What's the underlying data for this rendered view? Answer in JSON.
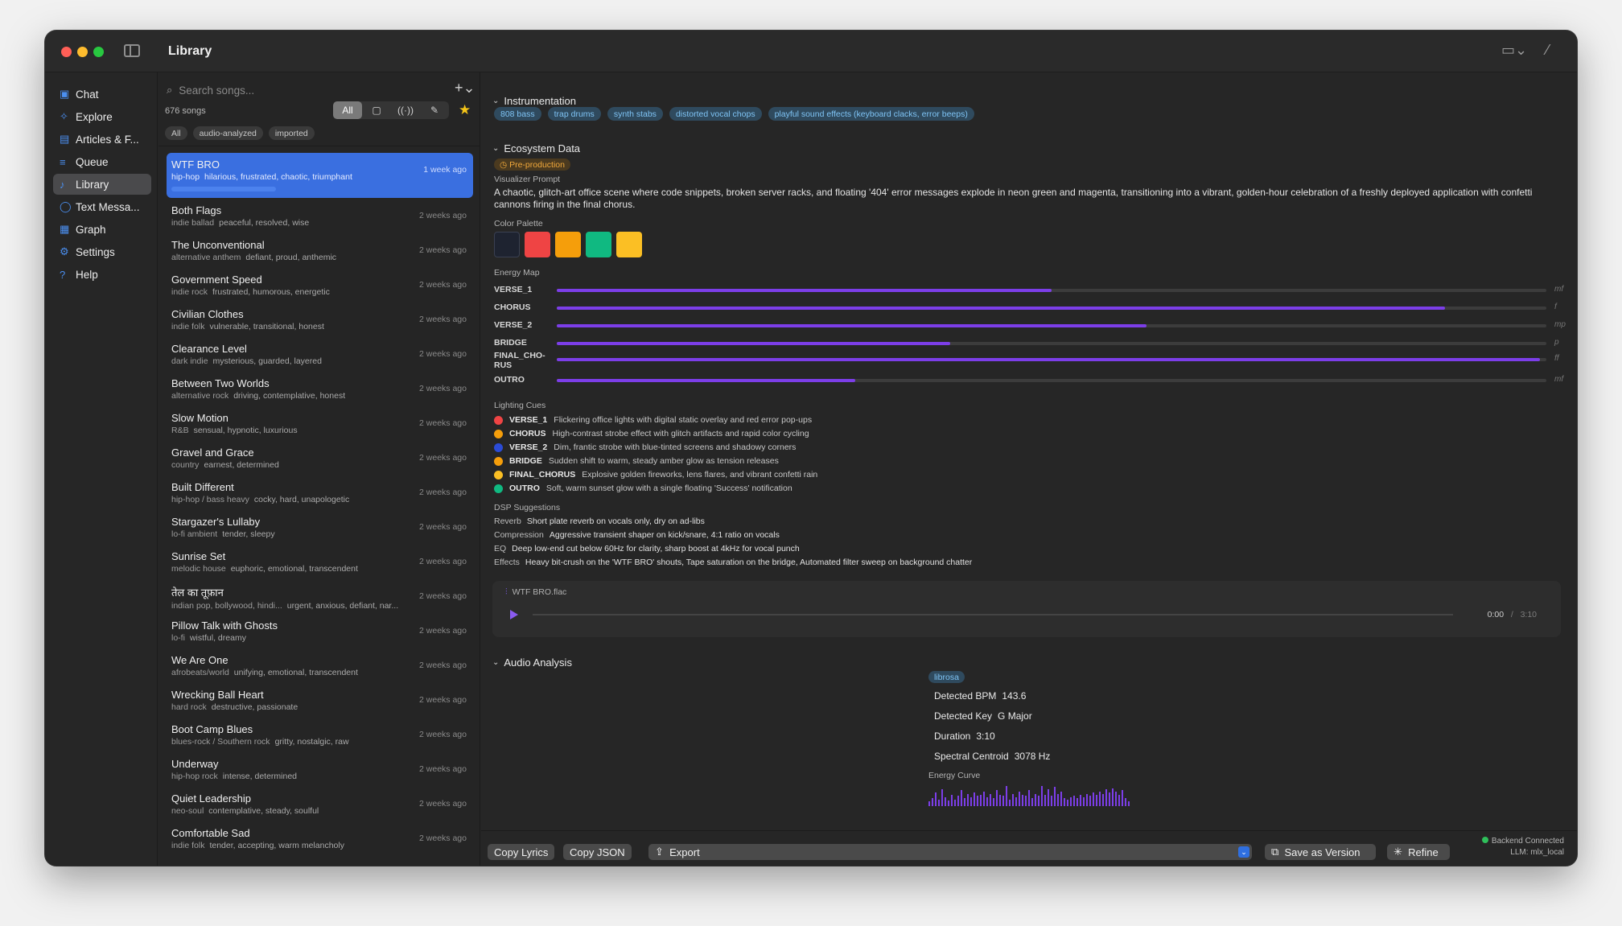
{
  "window": {
    "title": "Library"
  },
  "sidebar": {
    "items": [
      {
        "label": "Chat",
        "icon": "chat-bubbles-icon",
        "glyph": "▣"
      },
      {
        "label": "Explore",
        "icon": "sparkles-icon",
        "glyph": "✧"
      },
      {
        "label": "Articles & F...",
        "icon": "newspaper-icon",
        "glyph": "▤"
      },
      {
        "label": "Queue",
        "icon": "list-icon",
        "glyph": "≡"
      },
      {
        "label": "Library",
        "icon": "music-note-icon",
        "glyph": "♪",
        "active": true
      },
      {
        "label": "Text Messa...",
        "icon": "message-icon",
        "glyph": "◯"
      },
      {
        "label": "Graph",
        "icon": "grid-icon",
        "glyph": "▦"
      },
      {
        "label": "Settings",
        "icon": "gear-icon",
        "glyph": "⚙"
      },
      {
        "label": "Help",
        "icon": "question-icon",
        "glyph": "?"
      }
    ]
  },
  "library": {
    "search_placeholder": "Search songs...",
    "count": "676 songs",
    "filter_all": "All",
    "chips": [
      "All",
      "audio-analyzed",
      "imported"
    ],
    "songs": [
      {
        "title": "WTF BRO",
        "genre": "hip-hop",
        "moods": "hilarious, frustrated, chaotic, triumphant",
        "when": "1 week ago",
        "selected": true
      },
      {
        "title": "Both Flags",
        "genre": "indie ballad",
        "moods": "peaceful, resolved, wise",
        "when": "2 weeks ago"
      },
      {
        "title": "The Unconventional",
        "genre": "alternative anthem",
        "moods": "defiant, proud, anthemic",
        "when": "2 weeks ago"
      },
      {
        "title": "Government Speed",
        "genre": "indie rock",
        "moods": "frustrated, humorous, energetic",
        "when": "2 weeks ago"
      },
      {
        "title": "Civilian Clothes",
        "genre": "indie folk",
        "moods": "vulnerable, transitional, honest",
        "when": "2 weeks ago"
      },
      {
        "title": "Clearance Level",
        "genre": "dark indie",
        "moods": "mysterious, guarded, layered",
        "when": "2 weeks ago"
      },
      {
        "title": "Between Two Worlds",
        "genre": "alternative rock",
        "moods": "driving, contemplative, honest",
        "when": "2 weeks ago"
      },
      {
        "title": "Slow Motion",
        "genre": "R&B",
        "moods": "sensual, hypnotic, luxurious",
        "when": "2 weeks ago"
      },
      {
        "title": "Gravel and Grace",
        "genre": "country",
        "moods": "earnest, determined",
        "when": "2 weeks ago"
      },
      {
        "title": "Built Different",
        "genre": "hip-hop / bass heavy",
        "moods": "cocky, hard, unapologetic",
        "when": "2 weeks ago"
      },
      {
        "title": "Stargazer's Lullaby",
        "genre": "lo-fi ambient",
        "moods": "tender, sleepy",
        "when": "2 weeks ago"
      },
      {
        "title": "Sunrise Set",
        "genre": "melodic house",
        "moods": "euphoric, emotional, transcendent",
        "when": "2 weeks ago"
      },
      {
        "title": "तेल का तूफ़ान",
        "genre": "indian pop, bollywood, hindi...",
        "moods": "urgent, anxious, defiant, nar...",
        "when": "2 weeks ago"
      },
      {
        "title": "Pillow Talk with Ghosts",
        "genre": "lo-fi",
        "moods": "wistful, dreamy",
        "when": "2 weeks ago"
      },
      {
        "title": "We Are One",
        "genre": "afrobeats/world",
        "moods": "unifying, emotional, transcendent",
        "when": "2 weeks ago"
      },
      {
        "title": "Wrecking Ball Heart",
        "genre": "hard rock",
        "moods": "destructive, passionate",
        "when": "2 weeks ago"
      },
      {
        "title": "Boot Camp Blues",
        "genre": "blues-rock / Southern rock",
        "moods": "gritty, nostalgic, raw",
        "when": "2 weeks ago"
      },
      {
        "title": "Underway",
        "genre": "hip-hop rock",
        "moods": "intense, determined",
        "when": "2 weeks ago"
      },
      {
        "title": "Quiet Leadership",
        "genre": "neo-soul",
        "moods": "contemplative, steady, soulful",
        "when": "2 weeks ago"
      },
      {
        "title": "Comfortable Sad",
        "genre": "indie folk",
        "moods": "tender, accepting, warm melancholy",
        "when": "2 weeks ago"
      }
    ]
  },
  "detail": {
    "instrumentation_heading": "Instrumentation",
    "instruments": [
      "808 bass",
      "trap drums",
      "synth stabs",
      "distorted vocal chops",
      "playful sound effects (keyboard clacks, error beeps)"
    ],
    "ecosystem_heading": "Ecosystem Data",
    "phase": "Pre-production",
    "visualizer_label": "Visualizer Prompt",
    "visualizer_prompt": "A chaotic, glitch-art office scene where code snippets, broken server racks, and floating '404' error messages explode in neon green and magenta, transitioning into a vibrant, golden-hour celebration of a freshly deployed application with confetti cannons firing in the final chorus.",
    "palette_label": "Color Palette",
    "palette": [
      "#1e2330",
      "#ef4444",
      "#f59e0b",
      "#10b981",
      "#fbbf24"
    ],
    "energy_label": "Energy Map",
    "energy": [
      {
        "section": "VERSE_1",
        "level": 0.39,
        "dynamic": "mf"
      },
      {
        "section": "CHORUS",
        "level": 0.7,
        "dynamic": "f"
      },
      {
        "section": "VERSE_2",
        "level": 0.465,
        "dynamic": "mp"
      },
      {
        "section": "BRIDGE",
        "level": 0.31,
        "dynamic": "p"
      },
      {
        "section": "FINAL_CHO-RUS",
        "level": 0.775,
        "dynamic": "ff"
      },
      {
        "section": "OUTRO",
        "level": 0.235,
        "dynamic": "mf"
      }
    ],
    "lighting_label": "Lighting Cues",
    "lighting": [
      {
        "section": "VERSE_1",
        "color": "#ef4444",
        "cue": "Flickering office lights with digital static overlay and red error pop-ups"
      },
      {
        "section": "CHORUS",
        "color": "#f59e0b",
        "cue": "High-contrast strobe effect with glitch artifacts and rapid color cycling"
      },
      {
        "section": "VERSE_2",
        "color": "#2b4bd6",
        "cue": "Dim, frantic strobe with blue-tinted screens and shadowy corners"
      },
      {
        "section": "BRIDGE",
        "color": "#f59e0b",
        "cue": "Sudden shift to warm, steady amber glow as tension releases"
      },
      {
        "section": "FINAL_CHORUS",
        "color": "#fbbf24",
        "cue": "Explosive golden fireworks, lens flares, and vibrant confetti rain"
      },
      {
        "section": "OUTRO",
        "color": "#10b981",
        "cue": "Soft, warm sunset glow with a single floating 'Success' notification"
      }
    ],
    "dsp_label": "DSP Suggestions",
    "dsp": [
      {
        "name": "Reverb",
        "text": "Short plate reverb on vocals only, dry on ad-libs"
      },
      {
        "name": "Compression",
        "text": "Aggressive transient shaper on kick/snare, 4:1 ratio on vocals"
      },
      {
        "name": "EQ",
        "text": "Deep low-end cut below 60Hz for clarity, sharp boost at 4kHz for vocal punch"
      },
      {
        "name": "Effects",
        "text": "Heavy bit-crush on the 'WTF BRO' shouts, Tape saturation on the bridge, Automated filter sweep on background chatter"
      }
    ],
    "player": {
      "file": "WTF BRO.flac",
      "current": "0:00",
      "sep": "/",
      "total": "3:10"
    },
    "audio_heading": "Audio Analysis",
    "analyzer": "librosa",
    "stats": [
      {
        "label": "Detected BPM",
        "value": "143.6"
      },
      {
        "label": "Detected Key",
        "value": "G Major"
      },
      {
        "label": "Duration",
        "value": "3:10"
      },
      {
        "label": "Spectral Centroid",
        "value": "3078 Hz"
      }
    ],
    "curve_label": "Energy Curve",
    "energy_curve": [
      0.2,
      0.35,
      0.6,
      0.3,
      0.75,
      0.4,
      0.25,
      0.5,
      0.3,
      0.45,
      0.7,
      0.35,
      0.55,
      0.4,
      0.6,
      0.45,
      0.5,
      0.65,
      0.4,
      0.55,
      0.35,
      0.7,
      0.5,
      0.45,
      0.9,
      0.3,
      0.55,
      0.4,
      0.65,
      0.5,
      0.45,
      0.7,
      0.35,
      0.55,
      0.45,
      0.9,
      0.5,
      0.75,
      0.45,
      0.85,
      0.55,
      0.65,
      0.35,
      0.3,
      0.4,
      0.45,
      0.35,
      0.5,
      0.4,
      0.55,
      0.45,
      0.6,
      0.5,
      0.65,
      0.55,
      0.75,
      0.6,
      0.8,
      0.65,
      0.5,
      0.7,
      0.35,
      0.2
    ]
  },
  "footer": {
    "copy_lyrics": "Copy Lyrics",
    "copy_json": "Copy JSON",
    "export": "Export",
    "save_version": "Save as Version",
    "refine": "Refine",
    "status": "Backend Connected",
    "llm": "LLM: mlx_local"
  }
}
